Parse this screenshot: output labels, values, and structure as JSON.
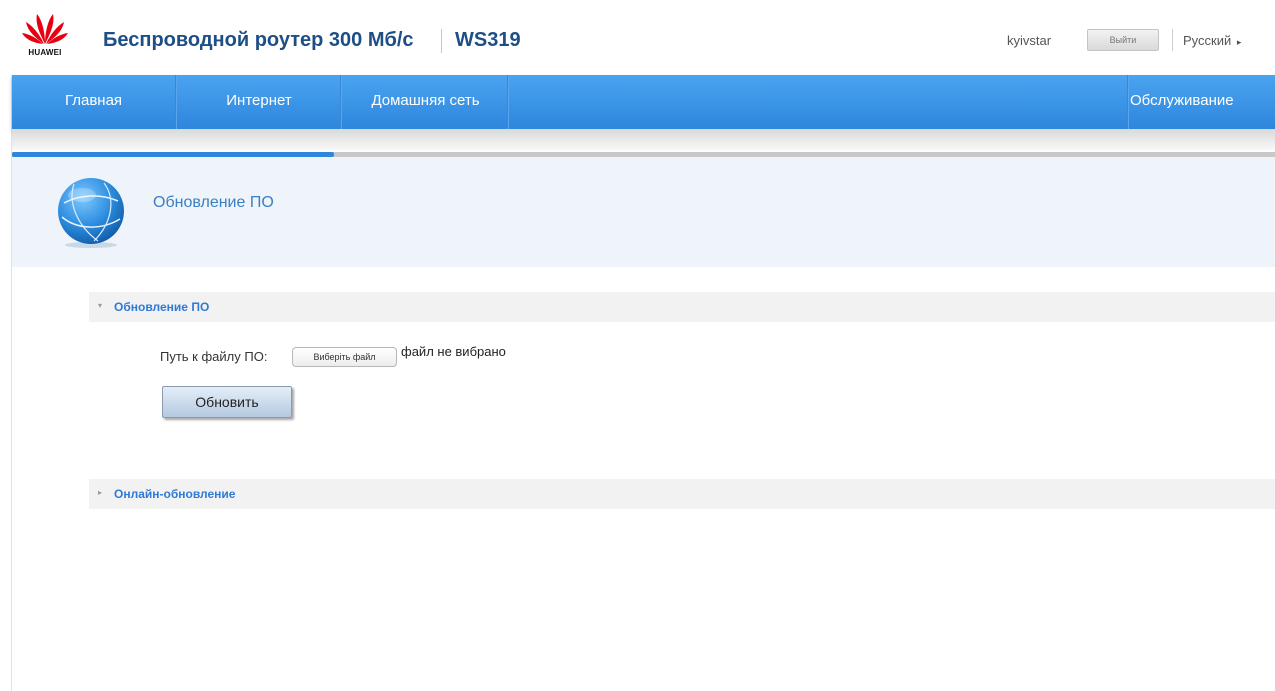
{
  "header": {
    "logo_text": "HUAWEI",
    "product_title": "Беспроводной роутер 300 Мб/с",
    "model": "WS319",
    "username": "kyivstar",
    "logout_label": "Выйти",
    "language": "Русский",
    "language_arrow": "▸"
  },
  "nav": {
    "items": [
      {
        "label": "Главная"
      },
      {
        "label": "Интернет"
      },
      {
        "label": "Домашняя сеть"
      },
      {
        "label": "Обслуживание"
      }
    ]
  },
  "progress": {
    "fraction": 0.255
  },
  "page": {
    "title": "Обновление ПО"
  },
  "sections": [
    {
      "label": "Обновление ПО",
      "expanded": true,
      "caret": "▾",
      "file_label": "Путь к файлу ПО:",
      "choose_file_label": "Виберіть файл",
      "file_status": "файл не вибрано",
      "update_button": "Обновить"
    },
    {
      "label": "Онлайн-обновление",
      "expanded": false,
      "caret": "▸"
    }
  ],
  "colors": {
    "brand_blue": "#2e86dd",
    "title_blue": "#1d4f86",
    "link_blue": "#2e7ad6",
    "huawei_red": "#e60012"
  },
  "icons": {
    "logo": "huawei-logo",
    "page_icon": "globe-icon"
  }
}
